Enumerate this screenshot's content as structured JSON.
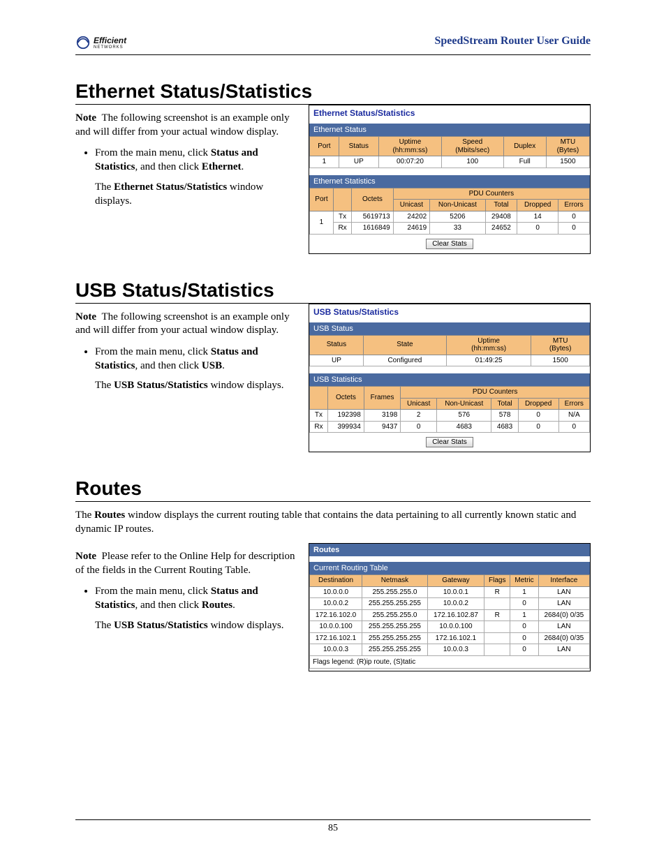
{
  "header": {
    "logo_brand": "Efficient",
    "logo_sub": "NETWORKS",
    "guide_title": "SpeedStream Router User Guide"
  },
  "ethernet": {
    "heading": "Ethernet Status/Statistics",
    "note_label": "Note",
    "note_text": "The following screenshot is an example only and will differ from your actual window display.",
    "bullet_prefix": "From the main menu, click ",
    "bullet_strong1": "Status and Statistics",
    "bullet_mid": ", and then click ",
    "bullet_strong2": "Ethernet",
    "bullet_end": ".",
    "result_prefix": "The ",
    "result_strong": "Ethernet Status/Statistics",
    "result_end": " window displays.",
    "panel_title": "Ethernet Status/Statistics",
    "status_band": "Ethernet Status",
    "status_headers": [
      "Port",
      "Status",
      "Uptime\n(hh:mm:ss)",
      "Speed\n(Mbits/sec)",
      "Duplex",
      "MTU\n(Bytes)"
    ],
    "status_row": [
      "1",
      "UP",
      "00:07:20",
      "100",
      "Full",
      "1500"
    ],
    "stats_band": "Ethernet Statistics",
    "stats_h_port": "Port",
    "stats_h_blank": "",
    "stats_h_octets": "Octets",
    "stats_h_pdu": "PDU Counters",
    "stats_pdu_sub": [
      "Unicast",
      "Non-Unicast",
      "Total",
      "Dropped",
      "Errors"
    ],
    "stats_rows": [
      [
        "1",
        "Tx",
        "5619713",
        "24202",
        "5206",
        "29408",
        "14",
        "0"
      ],
      [
        "",
        "Rx",
        "1616849",
        "24619",
        "33",
        "24652",
        "0",
        "0"
      ]
    ],
    "clear_label": "Clear Stats"
  },
  "usb": {
    "heading": "USB Status/Statistics",
    "note_label": "Note",
    "note_text": "The following screenshot is an example only and will differ from your actual window display.",
    "bullet_prefix": "From the main menu, click ",
    "bullet_strong1": "Status and Statistics",
    "bullet_mid": ", and then click ",
    "bullet_strong2": "USB",
    "bullet_end": ".",
    "result_prefix": "The ",
    "result_strong": "USB Status/Statistics",
    "result_end": " window displays.",
    "panel_title": "USB Status/Statistics",
    "status_band": "USB Status",
    "status_headers": [
      "Status",
      "State",
      "Uptime\n(hh:mm:ss)",
      "MTU\n(Bytes)"
    ],
    "status_row": [
      "UP",
      "Configured",
      "01:49:25",
      "1500"
    ],
    "stats_band": "USB Statistics",
    "stats_h_blank": "",
    "stats_h_octets": "Octets",
    "stats_h_frames": "Frames",
    "stats_h_pdu": "PDU Counters",
    "stats_pdu_sub": [
      "Unicast",
      "Non-Unicast",
      "Total",
      "Dropped",
      "Errors"
    ],
    "stats_rows": [
      [
        "Tx",
        "192398",
        "3198",
        "2",
        "576",
        "578",
        "0",
        "N/A"
      ],
      [
        "Rx",
        "399934",
        "9437",
        "0",
        "4683",
        "4683",
        "0",
        "0"
      ]
    ],
    "clear_label": "Clear Stats"
  },
  "routes": {
    "heading": "Routes",
    "intro_prefix": "The ",
    "intro_strong": "Routes",
    "intro_text": " window displays the current routing table that contains the data pertaining to all currently known static and dynamic IP routes.",
    "note_label": "Note",
    "note_text": "Please refer to the Online Help for description of the fields in the Current Routing Table.",
    "bullet_prefix": "From the main menu, click ",
    "bullet_strong1": "Status and Statistics",
    "bullet_mid": ", and then click ",
    "bullet_strong2": "Routes",
    "bullet_end": ".",
    "result_prefix": "The ",
    "result_strong": "USB Status/Statistics",
    "result_end": " window displays.",
    "panel_title": "Routes",
    "table_band": "Current Routing Table",
    "table_headers": [
      "Destination",
      "Netmask",
      "Gateway",
      "Flags",
      "Metric",
      "Interface"
    ],
    "table_rows": [
      [
        "10.0.0.0",
        "255.255.255.0",
        "10.0.0.1",
        "R",
        "1",
        "LAN"
      ],
      [
        "10.0.0.2",
        "255.255.255.255",
        "10.0.0.2",
        "",
        "0",
        "LAN"
      ],
      [
        "172.16.102.0",
        "255.255.255.0",
        "172.16.102.87",
        "R",
        "1",
        "2684(0) 0/35"
      ],
      [
        "10.0.0.100",
        "255.255.255.255",
        "10.0.0.100",
        "",
        "0",
        "LAN"
      ],
      [
        "172.16.102.1",
        "255.255.255.255",
        "172.16.102.1",
        "",
        "0",
        "2684(0) 0/35"
      ],
      [
        "10.0.0.3",
        "255.255.255.255",
        "10.0.0.3",
        "",
        "0",
        "LAN"
      ]
    ],
    "legend": "Flags legend: (R)ip route, (S)tatic"
  },
  "page_number": "85"
}
